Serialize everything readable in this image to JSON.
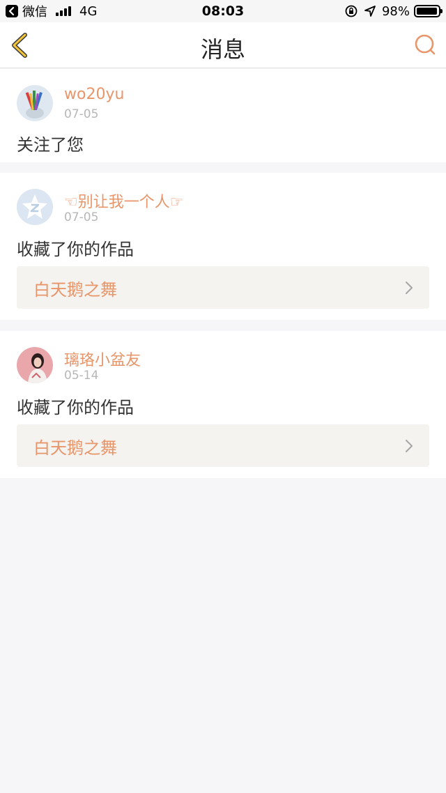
{
  "status_bar": {
    "back_app": "微信",
    "network": "4G",
    "time": "08:03",
    "battery": "98%"
  },
  "nav": {
    "title": "消息",
    "accent": "#e8956a",
    "back_icon": "chevron-left-icon",
    "search_icon": "search-icon"
  },
  "messages": [
    {
      "username": "wo20yu",
      "date": "07-05",
      "action": "关注了您",
      "avatar": "avatar-pencils"
    },
    {
      "username": "☜别让我一个人☞",
      "date": "07-05",
      "action": "收藏了你的作品",
      "work_title": "白天鹅之舞",
      "avatar": "avatar-default-qq"
    },
    {
      "username": "璃珞小盆友",
      "date": "05-14",
      "action": "收藏了你的作品",
      "work_title": "白天鹅之舞",
      "avatar": "avatar-girl"
    }
  ]
}
